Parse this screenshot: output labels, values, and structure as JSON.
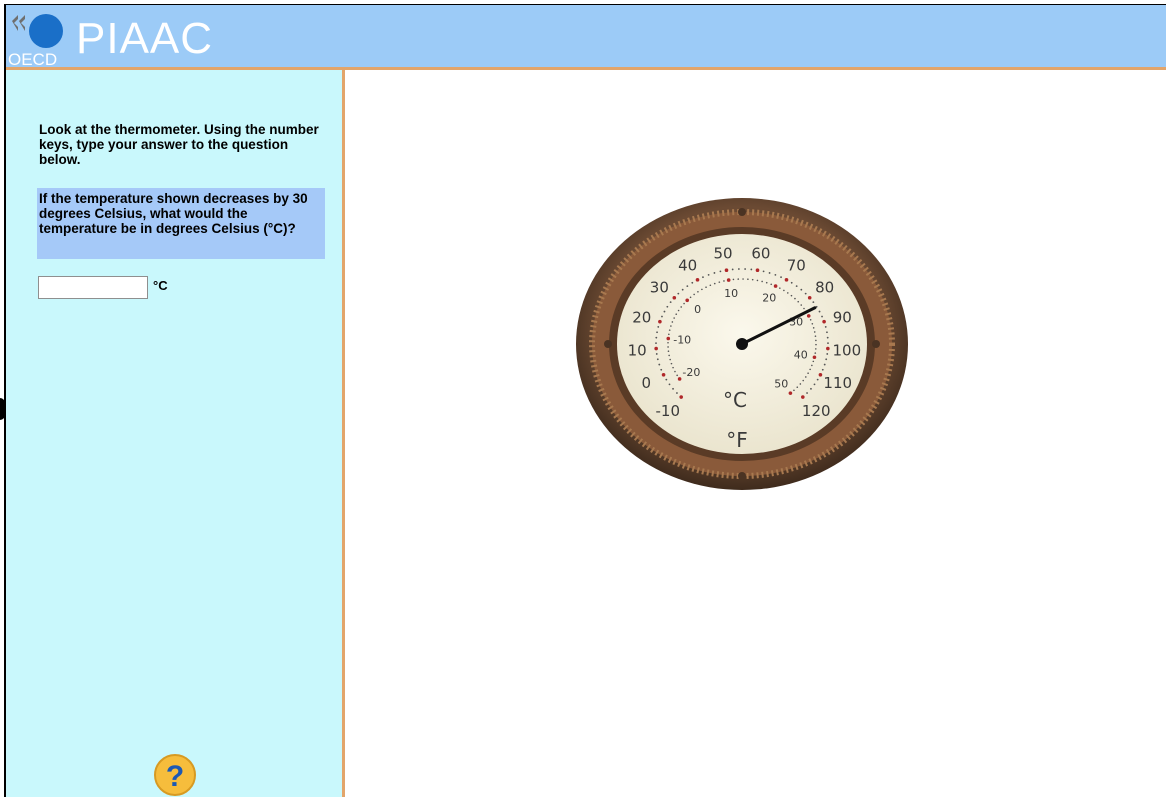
{
  "header": {
    "brand": "PIAAC",
    "oecd_label": "OECD"
  },
  "left_panel": {
    "instruction": "Look at the thermometer. Using the number keys, type your answer to the question below.",
    "question": "If the temperature shown decreases by 30 degrees Celsius, what would the temperature be in degrees Celsius (°C)?",
    "answer_value": "",
    "answer_unit": "°C",
    "help_label": "?"
  },
  "thermometer": {
    "fahrenheit_labels": [
      "-10",
      "0",
      "10",
      "20",
      "30",
      "40",
      "50",
      "60",
      "70",
      "80",
      "90",
      "100",
      "110",
      "120"
    ],
    "celsius_labels": [
      "-20",
      "-10",
      "0",
      "10",
      "20",
      "30",
      "40",
      "50"
    ],
    "celsius_unit": "°C",
    "fahrenheit_unit": "°F",
    "reading_fahrenheit": 84,
    "colors": {
      "rim_outer": "#3d2a1c",
      "rim_copper": "#8a5a3a",
      "dial_face": "#f6f2e2",
      "tick_dot": "#b0282a",
      "text": "#3a3a3a"
    }
  },
  "colors": {
    "header_bg": "#9ccbf7",
    "left_panel_bg": "#c9f8fc",
    "question_bg": "#a5c9f8",
    "divider": "#e2a56b",
    "help_yellow": "#f6bd3c",
    "help_blue": "#1b59b5"
  }
}
